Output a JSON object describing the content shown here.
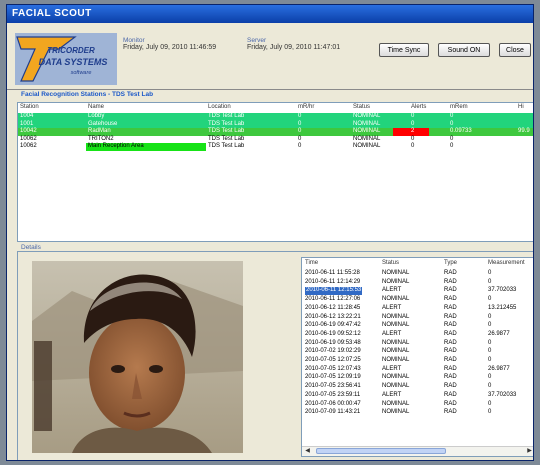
{
  "window": {
    "title": "FACIAL SCOUT"
  },
  "logo": {
    "line1": "TRICORDER",
    "line2": "DATA SYSTEMS",
    "line3": "software"
  },
  "monitor": {
    "label": "Monitor",
    "value": "Friday, July 09, 2010 11:46:59"
  },
  "server": {
    "label": "Server",
    "value": "Friday, July 09, 2010 11:47:01"
  },
  "buttons": {
    "time_sync": "Time Sync",
    "sound": "Sound ON",
    "close": "Close"
  },
  "stations": {
    "title": "Facial Recognition Stations - TDS Test Lab",
    "columns": [
      "Station",
      "Name",
      "Location",
      "mR/hr",
      "Status",
      "Alerts",
      "mRem",
      "Hi"
    ],
    "rows": [
      [
        "1004",
        "Lobby",
        "TDS Test Lab",
        "0",
        "NOMINAL",
        "0",
        "0",
        ""
      ],
      [
        "1001",
        "Gatehouse",
        "TDS Test Lab",
        "0",
        "NOMINAL",
        "0",
        "0",
        ""
      ],
      [
        "10042",
        "RadMan",
        "TDS Test Lab",
        "0",
        "NOMINAL",
        "2",
        "0.09733",
        "99.9"
      ],
      [
        "10062",
        "TRITON2",
        "TDS Test Lab",
        "0",
        "NOMINAL",
        "0",
        "0",
        ""
      ],
      [
        "10062",
        "Main Reception Area",
        "TDS Test Lab",
        "0",
        "NOMINAL",
        "0",
        "0",
        ""
      ]
    ],
    "colors": {
      "green": "#22d47c",
      "selected": "#3ec83e",
      "alert": "#ff0000",
      "bright_green": "#17e317"
    }
  },
  "details": {
    "title": "Details",
    "log_columns": [
      "Time",
      "Status",
      "Type",
      "Measurement"
    ],
    "log_rows": [
      [
        "2010-06-11 11:55:28",
        "NOMINAL",
        "RAD",
        "0"
      ],
      [
        "2010-06-11 12:14:29",
        "NOMINAL",
        "RAD",
        "0"
      ],
      [
        "2010-06-11 12:15:53",
        "ALERT",
        "RAD",
        "37.702033"
      ],
      [
        "2010-06-11 12:27:06",
        "NOMINAL",
        "RAD",
        "0"
      ],
      [
        "2010-06-12 11:28:45",
        "ALERT",
        "RAD",
        "13.212455"
      ],
      [
        "2010-06-12 13:22:21",
        "NOMINAL",
        "RAD",
        "0"
      ],
      [
        "2010-06-19 09:47:42",
        "NOMINAL",
        "RAD",
        "0"
      ],
      [
        "2010-06-19 09:52:12",
        "ALERT",
        "RAD",
        "26.9877"
      ],
      [
        "2010-06-19 09:53:48",
        "NOMINAL",
        "RAD",
        "0"
      ],
      [
        "2010-07-02 19:02:29",
        "NOMINAL",
        "RAD",
        "0"
      ],
      [
        "2010-07-05 12:07:25",
        "NOMINAL",
        "RAD",
        "0"
      ],
      [
        "2010-07-05 12:07:43",
        "ALERT",
        "RAD",
        "26.9877"
      ],
      [
        "2010-07-05 12:09:19",
        "NOMINAL",
        "RAD",
        "0"
      ],
      [
        "2010-07-05 23:56:41",
        "NOMINAL",
        "RAD",
        "0"
      ],
      [
        "2010-07-05 23:59:11",
        "ALERT",
        "RAD",
        "37.702033"
      ],
      [
        "2010-07-06 00:00:47",
        "NOMINAL",
        "RAD",
        "0"
      ],
      [
        "2010-07-09 11:43:21",
        "NOMINAL",
        "RAD",
        "0"
      ]
    ],
    "selected_row": 2,
    "selected_color": "#316ac5"
  }
}
